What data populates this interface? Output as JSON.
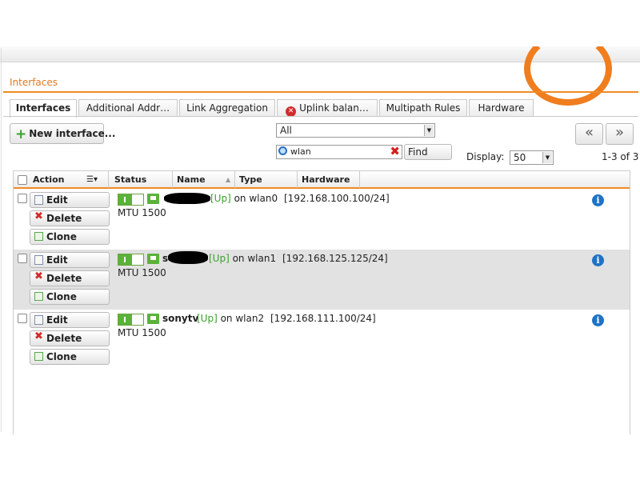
{
  "section_title": "Interfaces",
  "tabs": [
    {
      "label": "Interfaces",
      "active": true
    },
    {
      "label": "Additional Addr…"
    },
    {
      "label": "Link Aggregation"
    },
    {
      "label": "Uplink balan…",
      "icon": "error-icon"
    },
    {
      "label": "Multipath Rules"
    },
    {
      "label": "Hardware"
    }
  ],
  "toolbar": {
    "new_label": "New interface...",
    "filter_value": "All",
    "search_value": "wlan",
    "find_label": "Find",
    "display_label": "Display:",
    "display_value": "50",
    "count_text": "1-3 of 3",
    "prev_label": "«",
    "next_label": "»"
  },
  "columns": {
    "action": "Action",
    "status": "Status",
    "name": "Name",
    "type": "Type",
    "hardware": "Hardware"
  },
  "row_buttons": {
    "edit": "Edit",
    "delete": "Delete",
    "clone": "Clone"
  },
  "rows": [
    {
      "name": "",
      "state": "[Up]",
      "on": "on wlan0",
      "ip": "[192.168.100.100/24]",
      "mtu": "MTU 1500",
      "redacted": true
    },
    {
      "name": "s",
      "state": "[Up]",
      "on": "on wlan1",
      "ip": "[192.168.125.125/24]",
      "mtu": "MTU 1500",
      "redacted": true
    },
    {
      "name": "sonytv",
      "state": "[Up]",
      "on": "on wlan2",
      "ip": "[192.168.111.100/24]",
      "mtu": "MTU 1500",
      "redacted": false
    }
  ],
  "colors": {
    "accent": "#f08a24",
    "up": "#3aa12b",
    "info": "#1e73c8"
  }
}
